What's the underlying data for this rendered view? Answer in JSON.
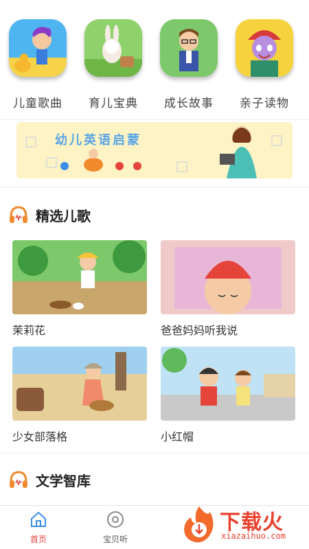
{
  "categories": [
    {
      "label": "儿童歌曲",
      "icon": "child-songs-icon"
    },
    {
      "label": "育儿宝典",
      "icon": "parenting-guide-icon"
    },
    {
      "label": "成长故事",
      "icon": "growth-stories-icon"
    },
    {
      "label": "亲子读物",
      "icon": "parent-child-reading-icon"
    }
  ],
  "banner": {
    "text": "幼儿英语启蒙"
  },
  "sections": {
    "songs": {
      "title": "精选儿歌",
      "items": [
        {
          "title": "茉莉花"
        },
        {
          "title": "爸爸妈妈听我说"
        },
        {
          "title": "少女部落格"
        },
        {
          "title": "小红帽"
        }
      ]
    },
    "library": {
      "title": "文学智库"
    }
  },
  "bottom_nav": {
    "home": "首页",
    "listen": "宝贝听"
  },
  "watermark": {
    "brand": "下载火",
    "url": "xiazaihuo.com"
  },
  "colors": {
    "accent": "#e5443b",
    "headphone": "#f08a2c",
    "nav_home_icon": "#3a8ee6"
  }
}
